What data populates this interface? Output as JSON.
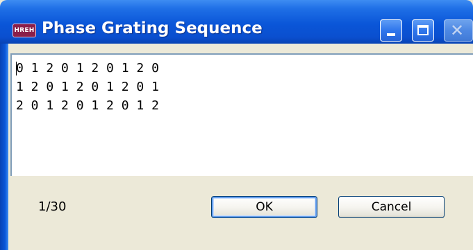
{
  "window": {
    "title": "Phase Grating Sequence",
    "app_icon_text": "HREH",
    "close_symbol": "✕"
  },
  "sequence": {
    "lines": [
      "0 1 2 0 1 2 0 1 2 0",
      "1 2 0 1 2 0 1 2 0 1",
      "2 0 1 2 0 1 2 0 1 2"
    ]
  },
  "footer": {
    "counter": "1/30",
    "ok_label": "OK",
    "cancel_label": "Cancel"
  },
  "colors": {
    "titlebar": "#0a56d8",
    "dialog_bg": "#ece9d8",
    "default_button_ring": "#6aa2ee"
  },
  "icons": {
    "app": "app-icon",
    "minimize": "minimize-icon",
    "maximize": "maximize-icon",
    "close": "close-icon"
  }
}
